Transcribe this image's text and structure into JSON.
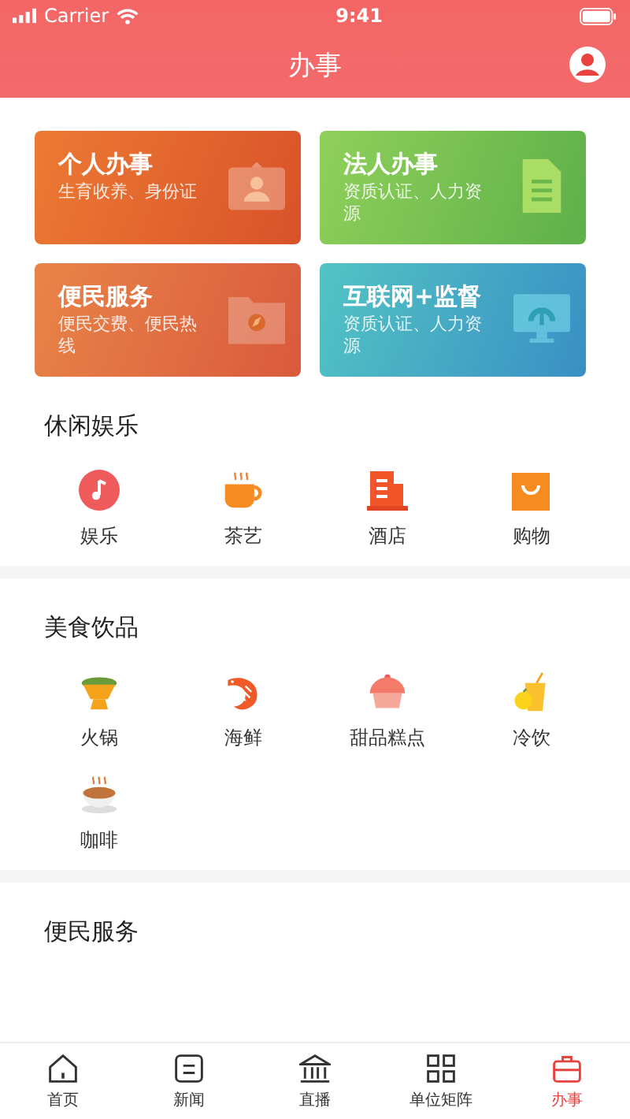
{
  "status_bar": {
    "carrier": "Carrier",
    "time": "9:41"
  },
  "header": {
    "title": "办事"
  },
  "cards": [
    {
      "kind": "personal",
      "title": "个人办事",
      "subtitle": "生育收养、身份证"
    },
    {
      "kind": "legal",
      "title": "法人办事",
      "subtitle": "资质认证、人力资源"
    },
    {
      "kind": "service",
      "title": "便民服务",
      "subtitle": "便民交费、便民热线"
    },
    {
      "kind": "internet",
      "title": "互联网+监督",
      "subtitle": "资质认证、人力资源"
    }
  ],
  "sections": [
    {
      "title": "休闲娱乐",
      "items": [
        {
          "kind": "music",
          "label": "娱乐"
        },
        {
          "kind": "tea",
          "label": "茶艺"
        },
        {
          "kind": "hotel",
          "label": "酒店"
        },
        {
          "kind": "shopping",
          "label": "购物"
        }
      ]
    },
    {
      "title": "美食饮品",
      "items": [
        {
          "kind": "hotpot",
          "label": "火锅"
        },
        {
          "kind": "shrimp",
          "label": "海鲜"
        },
        {
          "kind": "cake",
          "label": "甜品糕点"
        },
        {
          "kind": "juice",
          "label": "冷饮"
        },
        {
          "kind": "coffee",
          "label": "咖啡"
        }
      ]
    },
    {
      "title": "便民服务"
    }
  ],
  "tab_bar": [
    {
      "kind": "home",
      "label": "首页",
      "selected": false
    },
    {
      "kind": "news",
      "label": "新闻",
      "selected": false
    },
    {
      "kind": "live",
      "label": "直播",
      "selected": false
    },
    {
      "kind": "matrix",
      "label": "单位矩阵",
      "selected": false
    },
    {
      "kind": "affairs",
      "label": "办事",
      "selected": true
    }
  ]
}
